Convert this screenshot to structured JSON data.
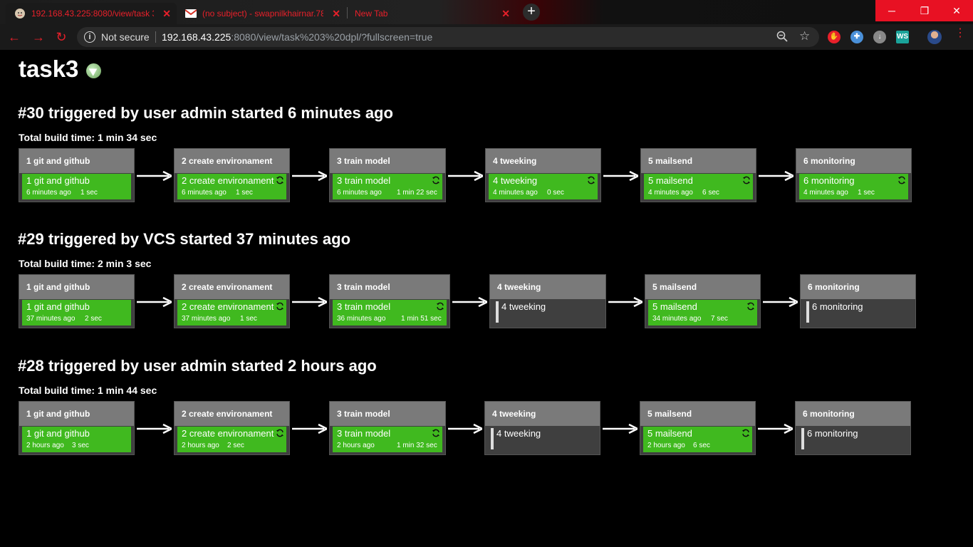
{
  "browser": {
    "tabs": [
      {
        "title": "192.168.43.225:8080/view/task 3",
        "active": true
      },
      {
        "title": "(no subject) - swapnilkhairnar.78",
        "active": false
      },
      {
        "title": "New Tab",
        "active": false
      }
    ],
    "address": {
      "security_label": "Not secure",
      "host": "192.168.43.225",
      "rest": ":8080/view/task%203%20dpl/?fullscreen=true"
    },
    "extensions": [
      {
        "icon": "hand-stop-icon",
        "color": "#e8202a"
      },
      {
        "icon": "shield-extension-icon",
        "color": "#4a90d9"
      },
      {
        "icon": "download-extension-icon",
        "color": "#888888"
      },
      {
        "icon": "ws-extension-icon",
        "label": "WS",
        "color": "#1aa39a"
      }
    ],
    "accent_color": "#e8202a"
  },
  "page": {
    "title": "task3",
    "success_color": "#40b91f",
    "runs": [
      {
        "header": "#30 triggered by user admin started 6 minutes ago",
        "total": "Total build time: 1 min 34 sec",
        "stages": [
          {
            "name": "1 git and github",
            "ago": "6 minutes ago",
            "duration": "1 sec",
            "status": "success",
            "refresh": false
          },
          {
            "name": "2 create environament",
            "ago": "6 minutes ago",
            "duration": "1 sec",
            "status": "success",
            "refresh": true
          },
          {
            "name": "3 train model",
            "ago": "6 minutes ago",
            "duration": "1 min 22 sec",
            "status": "success",
            "refresh": true
          },
          {
            "name": "4 tweeking",
            "ago": "4 minutes ago",
            "duration": "0 sec",
            "status": "success",
            "refresh": true
          },
          {
            "name": "5 mailsend",
            "ago": "4 minutes ago",
            "duration": "6 sec",
            "status": "success",
            "refresh": true
          },
          {
            "name": "6 monitoring",
            "ago": "4 minutes ago",
            "duration": "1 sec",
            "status": "success",
            "refresh": true
          }
        ]
      },
      {
        "header": "#29 triggered by VCS started 37 minutes ago",
        "total": "Total build time: 2 min 3 sec",
        "stages": [
          {
            "name": "1 git and github",
            "ago": "37 minutes ago",
            "duration": "2 sec",
            "status": "success",
            "refresh": false
          },
          {
            "name": "2 create environament",
            "ago": "37 minutes ago",
            "duration": "1 sec",
            "status": "success",
            "refresh": true
          },
          {
            "name": "3 train model",
            "ago": "36 minutes ago",
            "duration": "1 min 51 sec",
            "status": "success",
            "refresh": true
          },
          {
            "name": "4 tweeking",
            "ago": "",
            "duration": "",
            "status": "pending",
            "refresh": false
          },
          {
            "name": "5 mailsend",
            "ago": "34 minutes ago",
            "duration": "7 sec",
            "status": "success",
            "refresh": true
          },
          {
            "name": "6 monitoring",
            "ago": "",
            "duration": "",
            "status": "pending",
            "refresh": false
          }
        ]
      },
      {
        "header": "#28 triggered by user admin started 2 hours ago",
        "total": "Total build time: 1 min 44 sec",
        "stages": [
          {
            "name": "1 git and github",
            "ago": "2 hours ago",
            "duration": "3 sec",
            "status": "success",
            "refresh": false
          },
          {
            "name": "2 create environament",
            "ago": "2 hours ago",
            "duration": "2 sec",
            "status": "success",
            "refresh": true
          },
          {
            "name": "3 train model",
            "ago": "2 hours ago",
            "duration": "1 min 32 sec",
            "status": "success",
            "refresh": true
          },
          {
            "name": "4 tweeking",
            "ago": "",
            "duration": "",
            "status": "pending",
            "refresh": false
          },
          {
            "name": "5 mailsend",
            "ago": "2 hours ago",
            "duration": "6 sec",
            "status": "success",
            "refresh": true
          },
          {
            "name": "6 monitoring",
            "ago": "",
            "duration": "",
            "status": "pending",
            "refresh": false
          }
        ]
      }
    ]
  }
}
